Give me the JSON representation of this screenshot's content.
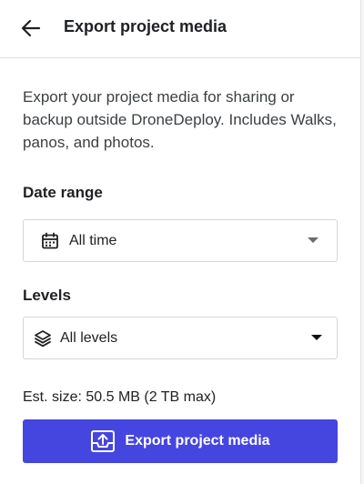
{
  "header": {
    "title": "Export project media",
    "back_icon": "arrow-left-icon"
  },
  "description": "Export your project media for sharing or backup outside DroneDeploy. Includes Walks, panos, and photos.",
  "date_range": {
    "label": "Date range",
    "selected": "All time",
    "icon": "calendar-icon"
  },
  "levels": {
    "label": "Levels",
    "selected": "All levels",
    "icon": "layers-icon"
  },
  "estimate": "Est. size: 50.5 MB (2 TB max)",
  "export_button": {
    "label": "Export project media",
    "icon": "export-tray-icon"
  },
  "colors": {
    "accent": "#4545e0",
    "text": "#202124",
    "border": "#d6d6d6"
  }
}
